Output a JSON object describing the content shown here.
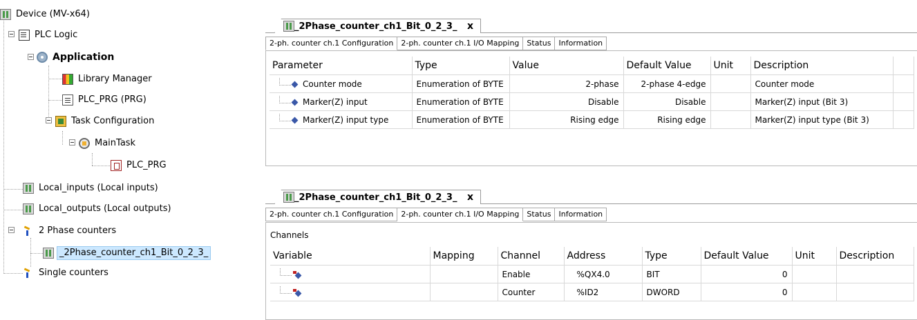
{
  "tree": {
    "device": "Device (MV-x64)",
    "plc_logic": "PLC Logic",
    "application": "Application",
    "library_manager": "Library Manager",
    "plc_prg": "PLC_PRG (PRG)",
    "task_configuration": "Task Configuration",
    "main_task": "MainTask",
    "main_task_prg": "PLC_PRG",
    "local_inputs": "Local_inputs (Local inputs)",
    "local_outputs": "Local_outputs (Local outputs)",
    "phase_counters": "2 Phase counters",
    "counter_module": "_2Phase_counter_ch1_Bit_0_2_3_",
    "single_counters": "Single counters"
  },
  "editor_top": {
    "doc_tab": "_2Phase_counter_ch1_Bit_0_2_3_",
    "close": "x",
    "subtabs": [
      "2-ph. counter ch.1 Configuration",
      "2-ph. counter ch.1 I/O Mapping",
      "Status",
      "Information"
    ],
    "active_subtab": 0,
    "columns": [
      "Parameter",
      "Type",
      "Value",
      "Default Value",
      "Unit",
      "Description"
    ],
    "rows": [
      {
        "parameter": "Counter mode",
        "type": "Enumeration of BYTE",
        "value": "2-phase",
        "default": "2-phase 4-edge",
        "unit": "",
        "description": "Counter mode"
      },
      {
        "parameter": "Marker(Z) input",
        "type": "Enumeration of BYTE",
        "value": "Disable",
        "default": "Disable",
        "unit": "",
        "description": "Marker(Z) input (Bit 3)"
      },
      {
        "parameter": "Marker(Z) input type",
        "type": "Enumeration of BYTE",
        "value": "Rising edge",
        "default": "Rising edge",
        "unit": "",
        "description": "Marker(Z) input type (Bit 3)"
      }
    ]
  },
  "editor_bottom": {
    "doc_tab": "_2Phase_counter_ch1_Bit_0_2_3_",
    "close": "x",
    "subtabs": [
      "2-ph. counter ch.1 Configuration",
      "2-ph. counter ch.1 I/O Mapping",
      "Status",
      "Information"
    ],
    "active_subtab": 1,
    "channels_label": "Channels",
    "columns": [
      "Variable",
      "Mapping",
      "Channel",
      "Address",
      "Type",
      "Default Value",
      "Unit",
      "Description"
    ],
    "rows": [
      {
        "variable": "",
        "mapping": "",
        "channel": "Enable",
        "address": "%QX4.0",
        "type": "BIT",
        "default": "0",
        "unit": "",
        "description": ""
      },
      {
        "variable": "",
        "mapping": "",
        "channel": "Counter",
        "address": "%ID2",
        "type": "DWORD",
        "default": "0",
        "unit": "",
        "description": ""
      }
    ]
  }
}
